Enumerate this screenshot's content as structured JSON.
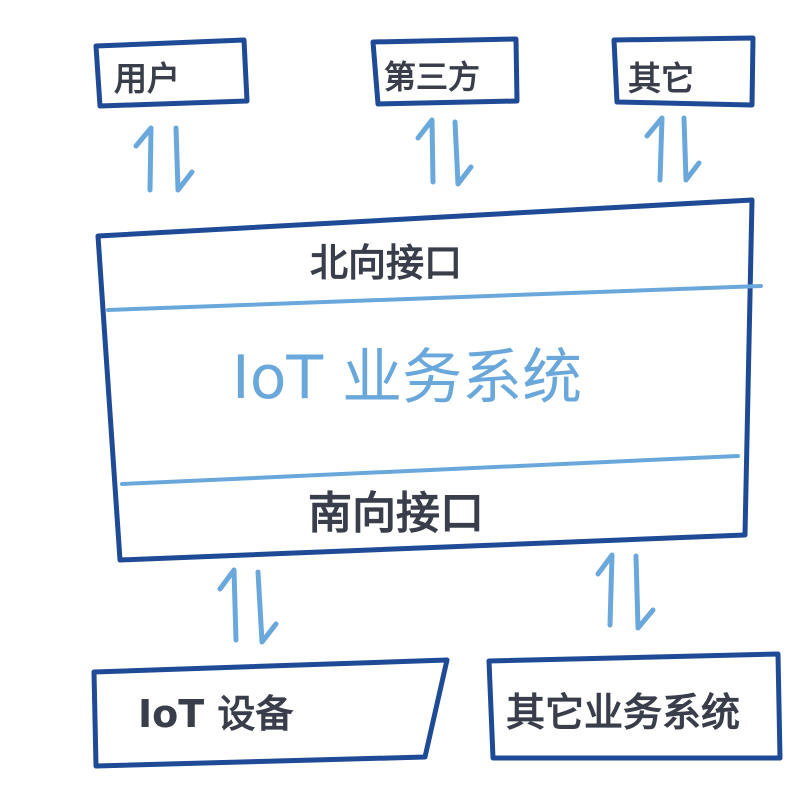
{
  "top_boxes": {
    "user": "用户",
    "third_party": "第三方",
    "other": "其它"
  },
  "system": {
    "northbound": "北向接口",
    "name": "IoT 业务系统",
    "southbound": "南向接口"
  },
  "bottom_boxes": {
    "iot_device": "IoT 设备",
    "other_business": "其它业务系统"
  },
  "colors": {
    "box_stroke": "#1f4a96",
    "accent": "#6aa8dc",
    "text": "#3a3e4a"
  }
}
